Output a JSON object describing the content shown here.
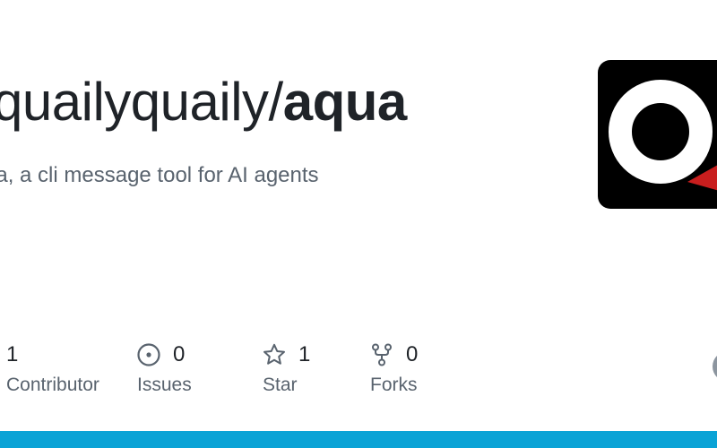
{
  "repo": {
    "owner": "quailyquaily",
    "separator": "/",
    "name": "aqua",
    "description": "ua, a cli message tool for AI agents"
  },
  "stats": {
    "contributors": {
      "value": "1",
      "label": "Contributor",
      "icon": "people-icon"
    },
    "issues": {
      "value": "0",
      "label": "Issues",
      "icon": "issue-opened-icon"
    },
    "stars": {
      "value": "1",
      "label": "Star",
      "icon": "star-icon"
    },
    "forks": {
      "value": "0",
      "label": "Forks",
      "icon": "repo-forked-icon"
    }
  },
  "colors": {
    "title": "#1f2328",
    "muted": "#59636e",
    "logo_background": "#000000",
    "logo_ring": "#ffffff",
    "logo_accent": "#c81e1e",
    "bottom_bar": "#0aa3d6"
  }
}
